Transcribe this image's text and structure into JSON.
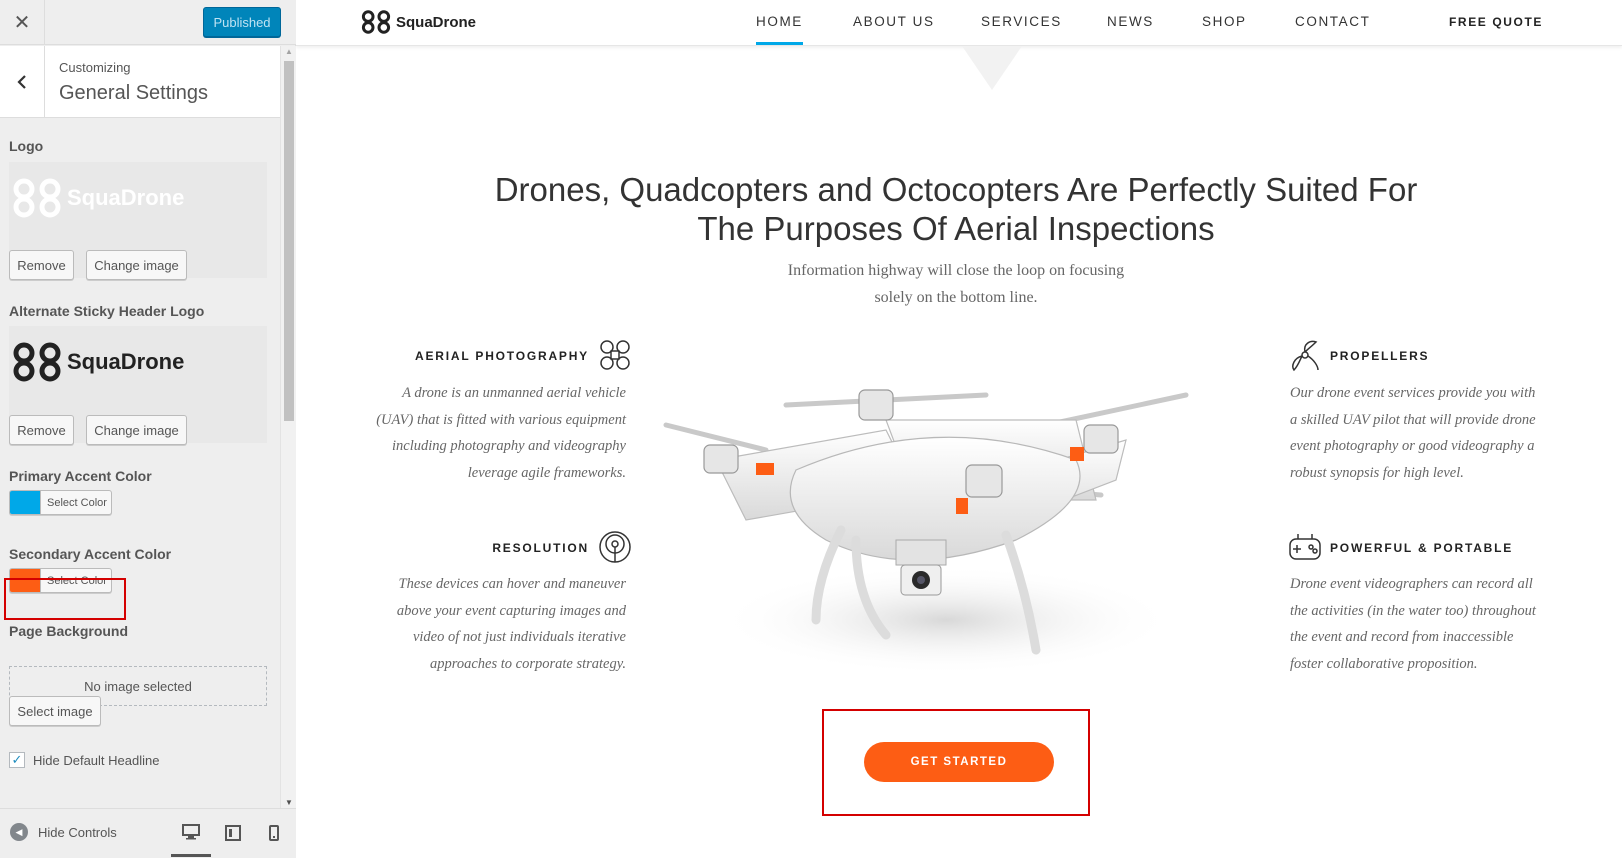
{
  "customizer": {
    "close_icon": "close-icon",
    "publish_label": "Published",
    "breadcrumb": "Customizing",
    "section_title": "General Settings",
    "logo": {
      "label": "Logo",
      "logo_text": "SquaDrone",
      "remove_label": "Remove",
      "change_label": "Change image"
    },
    "sticky_logo": {
      "label": "Alternate Sticky Header Logo",
      "logo_text": "SquaDrone",
      "remove_label": "Remove",
      "change_label": "Change image"
    },
    "primary_accent": {
      "label": "Primary Accent Color",
      "button": "Select Color",
      "color": "#00a8e8"
    },
    "secondary_accent": {
      "label": "Secondary Accent Color",
      "button": "Select Color",
      "color": "#fd5d14"
    },
    "page_background": {
      "label": "Page Background",
      "placeholder": "No image selected",
      "select_label": "Select image"
    },
    "hide_headline": {
      "label": "Hide Default Headline",
      "checked": true
    },
    "footer": {
      "hide_controls": "Hide Controls",
      "devices": [
        "desktop-icon",
        "tablet-icon",
        "mobile-icon"
      ],
      "active_device": "desktop"
    }
  },
  "site": {
    "brand": "SquaDrone",
    "nav": [
      {
        "label": "HOME",
        "active": true
      },
      {
        "label": "ABOUT US"
      },
      {
        "label": "SERVICES"
      },
      {
        "label": "NEWS"
      },
      {
        "label": "SHOP"
      },
      {
        "label": "CONTACT"
      }
    ],
    "quote": "FREE QUOTE",
    "headline_line1": "Drones, Quadcopters and Octocopters Are Perfectly Suited For",
    "headline_line2": "The Purposes Of Aerial Inspections",
    "subline_line1": "Information highway will close the loop on focusing",
    "subline_line2": "solely on the bottom line.",
    "features": {
      "aerial": {
        "title": "AERIAL PHOTOGRAPHY",
        "icon": "drone-icon",
        "lines": [
          "A drone is an unmanned aerial vehicle",
          "(UAV) that is fitted with various equipment",
          "including photography and videography",
          "leverage agile frameworks."
        ]
      },
      "resolution": {
        "title": "RESOLUTION",
        "icon": "signal-icon",
        "lines": [
          "These devices can hover and maneuver",
          "above your event capturing images and",
          "video of not just individuals iterative",
          "approaches to corporate strategy."
        ]
      },
      "propellers": {
        "title": "PROPELLERS",
        "icon": "propeller-icon",
        "lines": [
          "Our drone event services provide you with",
          "a skilled UAV pilot that will provide drone",
          "event photography or good videography a",
          "robust synopsis for high level."
        ]
      },
      "portable": {
        "title": "POWERFUL & PORTABLE",
        "icon": "gamepad-icon",
        "lines": [
          "Drone event videographers can record all",
          "the activities (in the water too) throughout",
          "the event and record from inaccessible",
          "foster collaborative proposition."
        ]
      }
    },
    "cta_label": "GET STARTED",
    "accent_color": "#fd5d14",
    "nav_underline_color": "#00a8e8"
  }
}
